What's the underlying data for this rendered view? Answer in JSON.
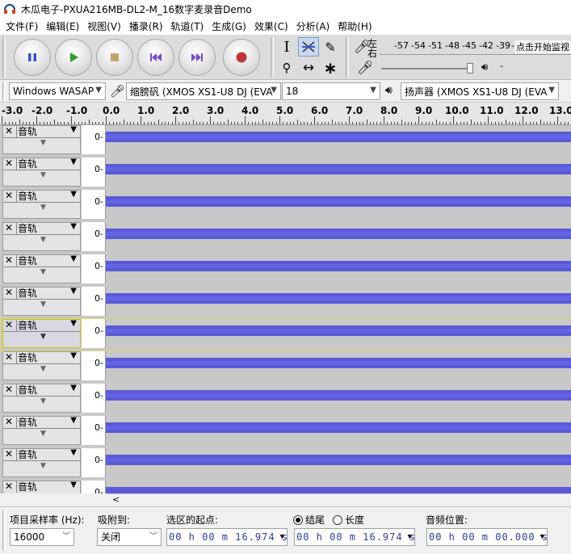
{
  "window": {
    "title": "木瓜电子-PXUA216MB-DL2-M_16数字麦录音Demo"
  },
  "menu": [
    "文件(F)",
    "编辑(E)",
    "视图(V)",
    "播录(R)",
    "轨道(T)",
    "生成(G)",
    "效果(C)",
    "分析(A)",
    "帮助(H)"
  ],
  "meter": {
    "lr_top": "左",
    "lr_bottom": "右",
    "scale": [
      "-57",
      "-54",
      "-51",
      "-48",
      "-45",
      "-42",
      "-39",
      "-"
    ],
    "monitor_label": "点击开始监视"
  },
  "devices": {
    "host": "Windows WASAP",
    "input": "缩膀矾 (XMOS XS1-U8 DJ (EVA",
    "channels": "18",
    "output": "扬声器 (XMOS XS1-U8 DJ (EVA"
  },
  "ruler": [
    "-3.0",
    "-2.0",
    "-1.0",
    "0.0",
    "1.0",
    "2.0",
    "3.0",
    "4.0",
    "5.0",
    "6.0",
    "7.0",
    "8.0",
    "9.0",
    "10.0",
    "11.0",
    "12.0",
    "13.0"
  ],
  "tracks": [
    {
      "name": "音轨",
      "scale": "0-"
    },
    {
      "name": "音轨",
      "scale": "0-"
    },
    {
      "name": "音轨",
      "scale": "0-"
    },
    {
      "name": "音轨",
      "scale": "0-"
    },
    {
      "name": "音轨",
      "scale": "0-"
    },
    {
      "name": "音轨",
      "scale": "0-"
    },
    {
      "name": "音轨",
      "scale": "0-"
    },
    {
      "name": "音轨",
      "scale": "0-"
    },
    {
      "name": "音轨",
      "scale": "0-"
    },
    {
      "name": "音轨",
      "scale": "0-"
    },
    {
      "name": "音轨",
      "scale": "0-"
    },
    {
      "name": "音轨",
      "scale": "0-"
    }
  ],
  "selection": {
    "rate_label": "项目采样率 (Hz):",
    "rate_value": "16000",
    "snap_label": "吸附到:",
    "snap_value": "关闭",
    "start_label": "选区的起点:",
    "start_value": "00 h 00 m 16.974 s",
    "end_option": "结尾",
    "length_option": "长度",
    "end_value": "00 h 00 m 16.974 s",
    "pos_label": "音频位置:",
    "pos_value": "00 h 00 m 00.000 s"
  },
  "colors": {
    "wave": "#5a5ad6",
    "record": "#c03838",
    "play": "#2aa02a",
    "pause": "#3355cc",
    "skip": "#7a4ad0"
  }
}
